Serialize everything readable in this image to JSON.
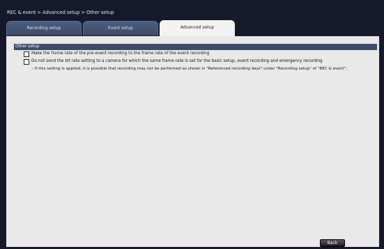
{
  "breadcrumb": "REC & event > Advanced setup > Other setup",
  "tabs": [
    {
      "label": "Recording setup",
      "active": false
    },
    {
      "label": "Event setup",
      "active": false
    },
    {
      "label": "Advanced setup",
      "active": true
    }
  ],
  "section": {
    "title": "Other setup",
    "options": [
      {
        "label": "Make the frame rate of the pre-event recording to the frame rate of the event recording",
        "checked": false
      },
      {
        "label": "Do not send the bit rate setting to a camera for which the same frame rate is set for the basic setup, event recording and emergency recording",
        "checked": false
      }
    ],
    "note": "- If this setting is applied, it is possible that recording may not be performed as shown in \"Referenced recording days\" under \"Recording setup\" of \"REC & event\"."
  },
  "footer": {
    "back_label": "Back"
  },
  "colors": {
    "background": "#15192b",
    "panel": "#e9e9e9",
    "section_header": "#3d4a6a",
    "tab_inactive": "#4c5f7f",
    "tab_active": "#f3f3f3"
  }
}
